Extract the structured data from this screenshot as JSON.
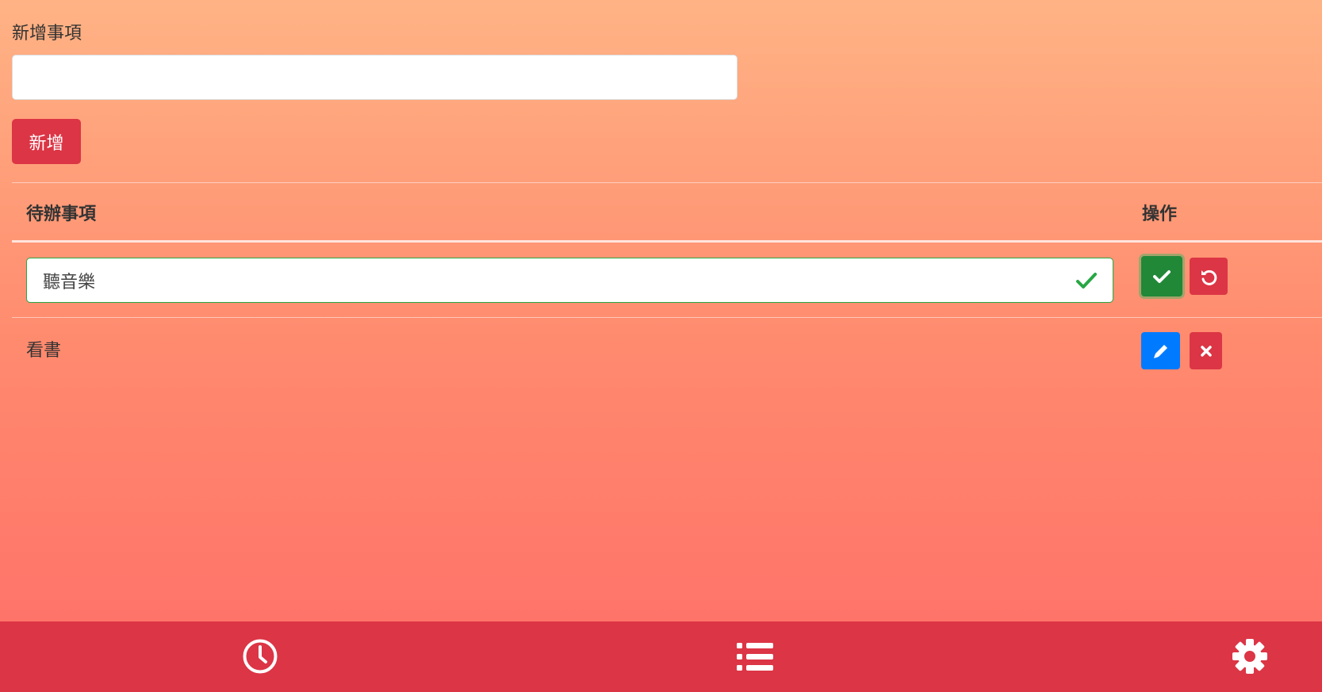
{
  "form": {
    "label": "新增事項",
    "input_value": "",
    "input_placeholder": "",
    "add_button_label": "新增"
  },
  "table": {
    "headers": {
      "task": "待辦事項",
      "actions": "操作"
    },
    "rows": [
      {
        "text": "聽音樂",
        "editing": true,
        "actions": [
          "check-icon",
          "undo-icon"
        ]
      },
      {
        "text": "看書",
        "editing": false,
        "actions": [
          "pencil-icon",
          "times-icon"
        ]
      }
    ]
  },
  "bottom_nav": {
    "items": [
      {
        "icon": "clock-icon"
      },
      {
        "icon": "list-icon"
      },
      {
        "icon": "gear-icon"
      }
    ]
  },
  "colors": {
    "danger": "#dc3545",
    "success": "#218838",
    "primary": "#007bff",
    "valid_border": "#28a745"
  }
}
